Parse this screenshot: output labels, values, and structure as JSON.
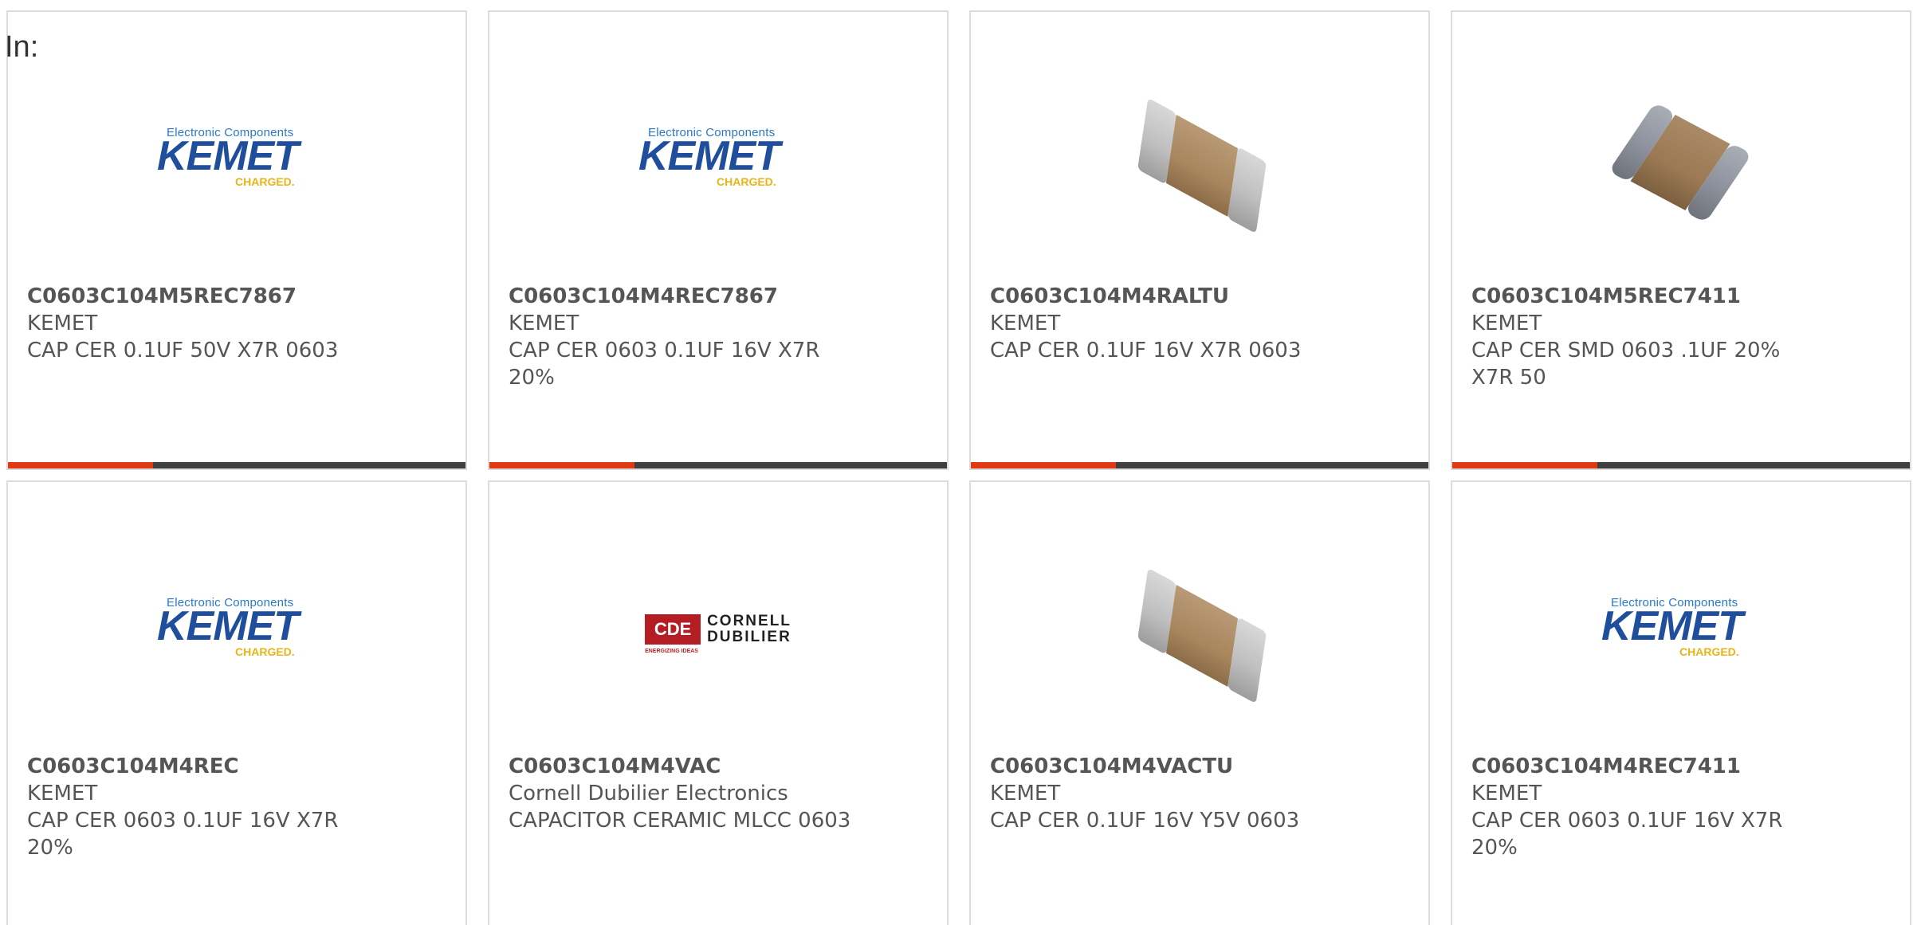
{
  "filter_label": "In:",
  "accent_color": "#e03a14",
  "bar_color": "#3f3f3f",
  "logos": {
    "kemet": {
      "tagline": "Electronic Components",
      "word": "KEMET",
      "sub": "CHARGED."
    },
    "cde": {
      "box": "CDE",
      "sub": "ENERGIZING IDEAS",
      "line1": "CORNELL",
      "line2": "DUBILIER"
    }
  },
  "products": [
    {
      "part_number": "C0603C104M5REC7867",
      "manufacturer": "KEMET",
      "description": "CAP CER 0.1UF 50V X7R 0603",
      "image": "kemet-logo"
    },
    {
      "part_number": "C0603C104M4REC7867",
      "manufacturer": "KEMET",
      "description": "CAP CER 0603 0.1UF 16V X7R 20%",
      "image": "kemet-logo"
    },
    {
      "part_number": "C0603C104M4RALTU",
      "manufacturer": "KEMET",
      "description": "CAP CER 0.1UF 16V X7R 0603",
      "image": "chip-capacitor"
    },
    {
      "part_number": "C0603C104M5REC7411",
      "manufacturer": "KEMET",
      "description": "CAP CER SMD 0603 .1UF 20% X7R 50",
      "image": "chip-capacitor-dark"
    },
    {
      "part_number": "C0603C104M4REC",
      "manufacturer": "KEMET",
      "description": "CAP CER 0603 0.1UF 16V X7R 20%",
      "image": "kemet-logo"
    },
    {
      "part_number": "C0603C104M4VAC",
      "manufacturer": "Cornell Dubilier Electronics",
      "description": "CAPACITOR CERAMIC MLCC 0603",
      "image": "cde-logo"
    },
    {
      "part_number": "C0603C104M4VACTU",
      "manufacturer": "KEMET",
      "description": "CAP CER 0.1UF 16V Y5V 0603",
      "image": "chip-capacitor"
    },
    {
      "part_number": "C0603C104M4REC7411",
      "manufacturer": "KEMET",
      "description": "CAP CER 0603 0.1UF 16V X7R 20%",
      "image": "kemet-logo"
    }
  ]
}
